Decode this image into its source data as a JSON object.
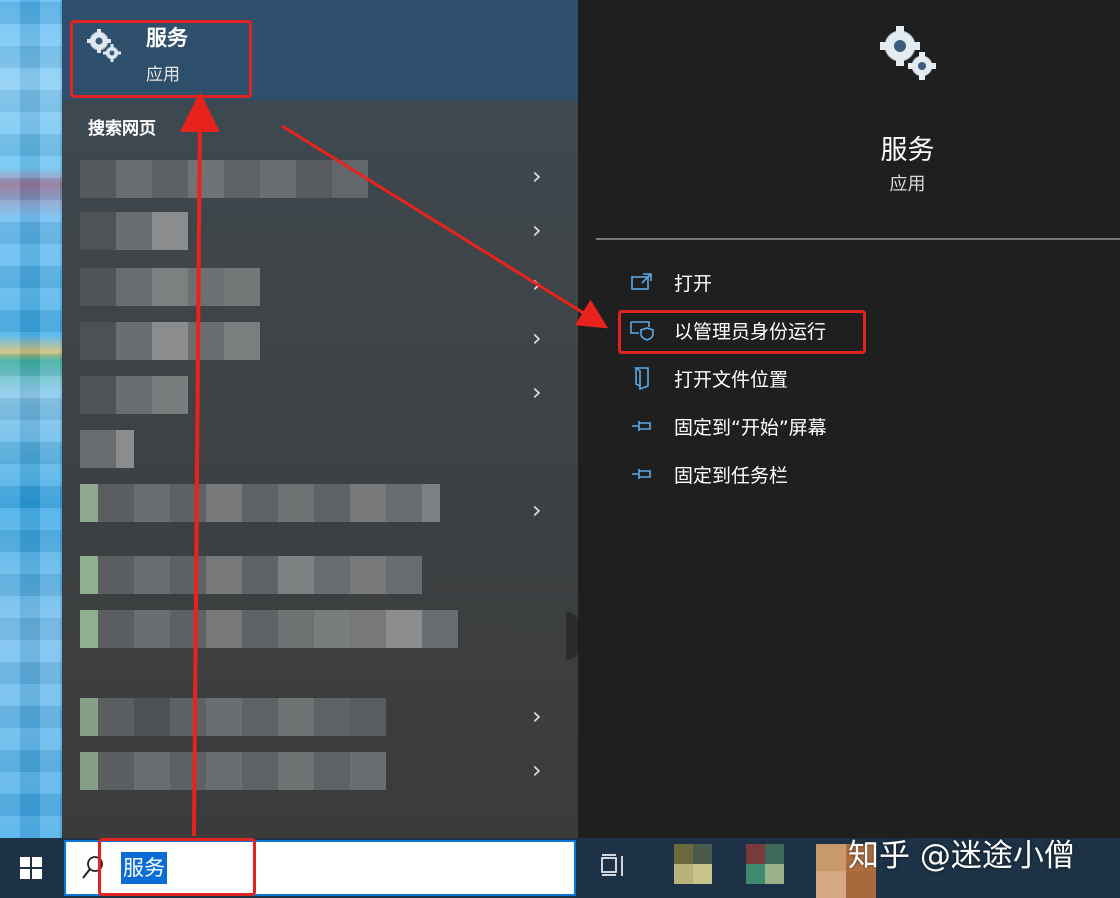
{
  "best_match": {
    "title": "服务",
    "subtitle": "应用"
  },
  "web_section": {
    "heading": "搜索网页"
  },
  "detail": {
    "title": "服务",
    "subtitle": "应用"
  },
  "actions": [
    {
      "label": "打开",
      "icon": "open-icon"
    },
    {
      "label": "以管理员身份运行",
      "icon": "shield-admin-icon"
    },
    {
      "label": "打开文件位置",
      "icon": "file-location-icon"
    },
    {
      "label": "固定到“开始”屏幕",
      "icon": "pin-icon"
    },
    {
      "label": "固定到任务栏",
      "icon": "pin-icon"
    }
  ],
  "search": {
    "value": "服务"
  },
  "watermark": "知乎 @迷途小僧",
  "colors": {
    "highlight_red": "#e0241f",
    "accent_blue": "#0a6cd6",
    "selected_bg": "#2d4f6c"
  }
}
